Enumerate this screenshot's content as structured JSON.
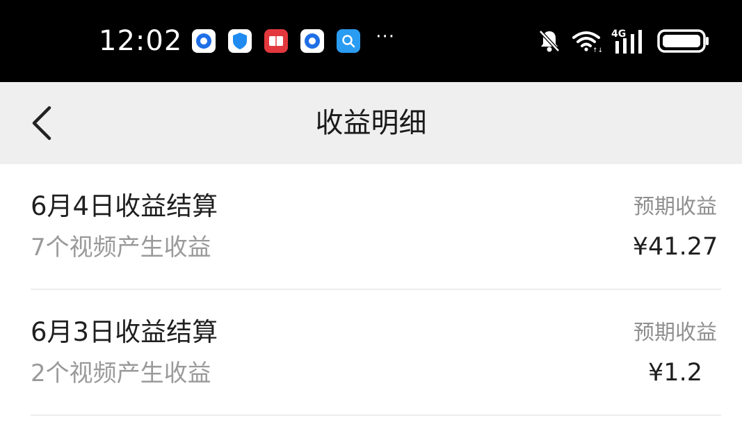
{
  "status_bar": {
    "time": "12:02",
    "more_indicator": "···",
    "network_label": "4G",
    "app_icons": [
      {
        "name": "app-icon-blue-ring",
        "bg": "#1f6fe6"
      },
      {
        "name": "app-icon-shield",
        "bg": "#1f8bf0"
      },
      {
        "name": "app-icon-red-book",
        "bg": "#e2383d"
      },
      {
        "name": "app-icon-blue-ring-2",
        "bg": "#1f6fe6"
      },
      {
        "name": "app-icon-search",
        "bg": "#2a9cf2"
      }
    ],
    "icons": [
      "bell-muted-icon",
      "wifi-icon",
      "signal-icon",
      "battery-icon"
    ]
  },
  "nav": {
    "back_icon": "chevron-left-icon",
    "title": "收益明细"
  },
  "list": {
    "items": [
      {
        "title": "6月4日收益结算",
        "subtitle": "7个视频产生收益",
        "right_label": "预期收益",
        "amount": "¥41.27"
      },
      {
        "title": "6月3日收益结算",
        "subtitle": "2个视频产生收益",
        "right_label": "预期收益",
        "amount": "¥1.2"
      }
    ]
  },
  "colors": {
    "status_bar_bg": "#000000",
    "nav_bg": "#efefef",
    "primary_text": "#1f1f1f",
    "secondary_text": "#9a9a9a"
  }
}
